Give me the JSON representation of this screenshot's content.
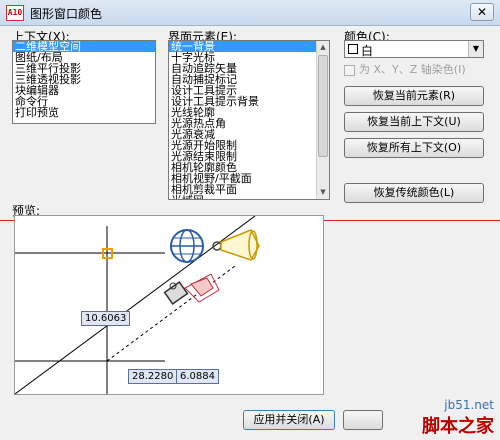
{
  "window": {
    "icon_text": "A10",
    "title": "图形窗口颜色",
    "close_glyph": "✕"
  },
  "context": {
    "label": "上下文(X):",
    "items": [
      "二维模型空间",
      "图纸/布局",
      "三维平行投影",
      "三维透视投影",
      "块编辑器",
      "命令行",
      "打印预览"
    ],
    "selected_index": 0
  },
  "interface": {
    "label": "界面元素(E):",
    "items": [
      "统一背景",
      "十字光标",
      "自动追踪矢量",
      "自动捕捉标记",
      "设计工具提示",
      "设计工具提示背景",
      "光线轮廓",
      "光源热点角",
      "光源衰减",
      "光源开始限制",
      "光源结束限制",
      "相机轮廓颜色",
      "相机视野/平截面",
      "相机剪裁平面",
      "光域网"
    ],
    "selected_index": 0
  },
  "color": {
    "label": "颜色(C):",
    "value": "白",
    "tint_label": "为 X、Y、Z 轴染色(I)",
    "swatch_color": "#ffffff"
  },
  "buttons": {
    "restore_element": "恢复当前元素(R)",
    "restore_context": "恢复当前上下文(U)",
    "restore_all": "恢复所有上下文(O)",
    "restore_classic": "恢复传统颜色(L)",
    "apply_close": "应用并关闭(A)"
  },
  "preview": {
    "label": "预览:",
    "coord_length": "10.6063",
    "coord_x": "28.2280",
    "coord_y": "6.0884"
  },
  "watermark": {
    "url": "jb51.net",
    "name": "脚本之家"
  }
}
